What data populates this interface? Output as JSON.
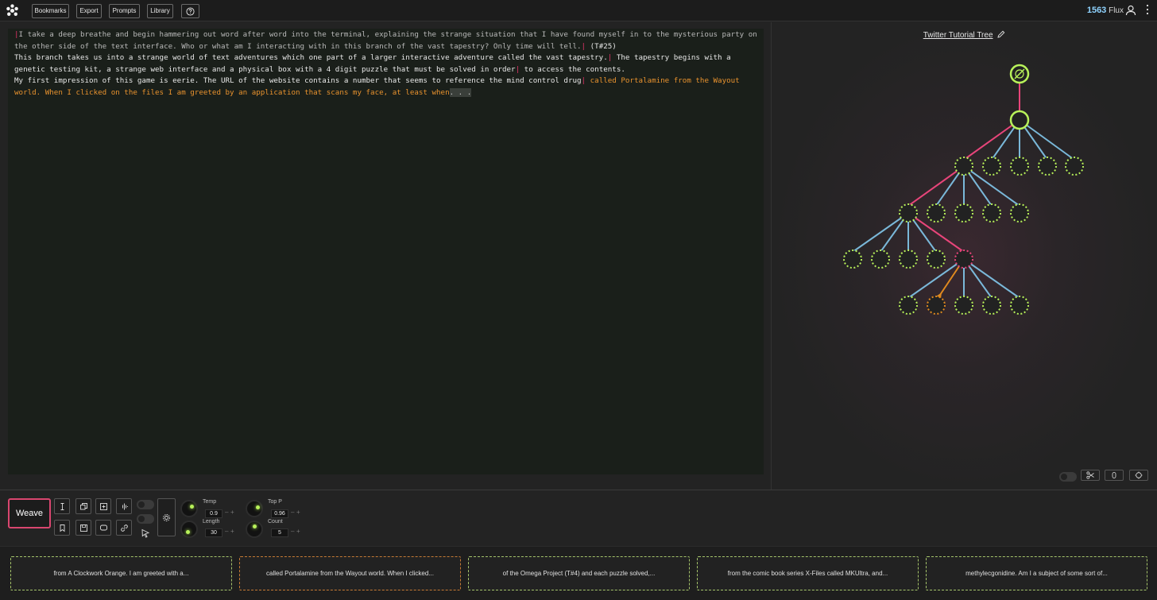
{
  "header": {
    "nav": [
      "Bookmarks",
      "Export",
      "Prompts",
      "Library"
    ],
    "help_icon": "help-circle-icon",
    "flux_count": "1563",
    "flux_label": "Flux"
  },
  "editor": {
    "segments": [
      {
        "cls": "t-grey",
        "text": "I take a deep breathe and begin hammering out word after word into the terminal, explaining the strange situation that I have found myself in to the mysterious party on the other side of the text interface. Who or what am I interacting with in this branch of the vast tapestry? Only time will tell."
      },
      {
        "cls": "t-white",
        "text": " (T#25)\nThis branch takes us into a strange world of text adventures which one part of a larger interactive adventure called the vast tapestry."
      },
      {
        "cls": "t-white",
        "text": " The tapestry begins with a genetic testing kit, a strange web interface and a physical box with a 4 digit puzzle that must be solved in order"
      },
      {
        "cls": "t-white",
        "text": " to access the contents.\nMy first impression of this game is eerie. The URL of the website contains a number that seems to reference the mind control drug"
      },
      {
        "cls": "t-orange",
        "text": " called Portalamine from the Wayout world. When I clicked on the files I am greeted by an application that scans my face, at least when"
      },
      {
        "cls": "dots",
        "text": ". . ."
      }
    ]
  },
  "tree": {
    "title": "Twitter Tutorial Tree"
  },
  "controls": {
    "weave_label": "Weave",
    "temp_label": "Temp",
    "temp_value": "0.9",
    "length_label": "Length",
    "length_value": "30",
    "top_p_label": "Top P",
    "top_p_value": "0.96",
    "count_label": "Count",
    "count_value": "5",
    "plus": "+",
    "minus": "–"
  },
  "choices": [
    "from A Clockwork Orange. I am greeted with a...",
    "called Portalamine from the Wayout world. When I clicked...",
    "of the Omega Project (T#4) and each puzzle solved,...",
    "from the comic book series X-Files called MKUltra, and...",
    "methylecgonidine. Am I a subject of some sort of..."
  ],
  "colors": {
    "accent_pink": "#d9466f",
    "node_green": "#b8f25a",
    "edge_blue": "#7ab8d9",
    "active_orange": "#e8922e"
  }
}
